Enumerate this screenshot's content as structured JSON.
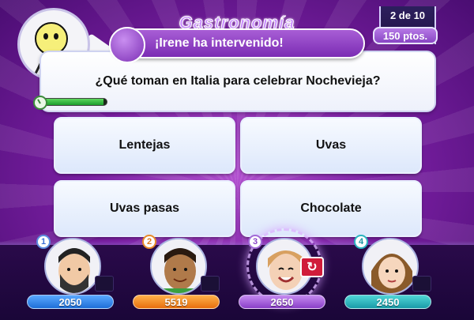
{
  "header": {
    "category": "Gastronomía",
    "question_counter": "2 de 10",
    "points": "150 ptos."
  },
  "banner": {
    "text": "¡Irene ha intervenido!"
  },
  "question": {
    "text": "¿Qué toman en Italia para celebrar Nochevieja?",
    "timer_fraction": 0.95
  },
  "answers": [
    {
      "label": "Lentejas"
    },
    {
      "label": "Uvas"
    },
    {
      "label": "Uvas pasas"
    },
    {
      "label": "Chocolate"
    }
  ],
  "players": [
    {
      "number": "1",
      "score": "2050",
      "color": "#1f6fd8"
    },
    {
      "number": "2",
      "score": "5519",
      "color": "#e86f0e"
    },
    {
      "number": "3",
      "score": "2650",
      "color": "#8a40c8"
    },
    {
      "number": "4",
      "score": "2450",
      "color": "#1a9ba8"
    }
  ]
}
